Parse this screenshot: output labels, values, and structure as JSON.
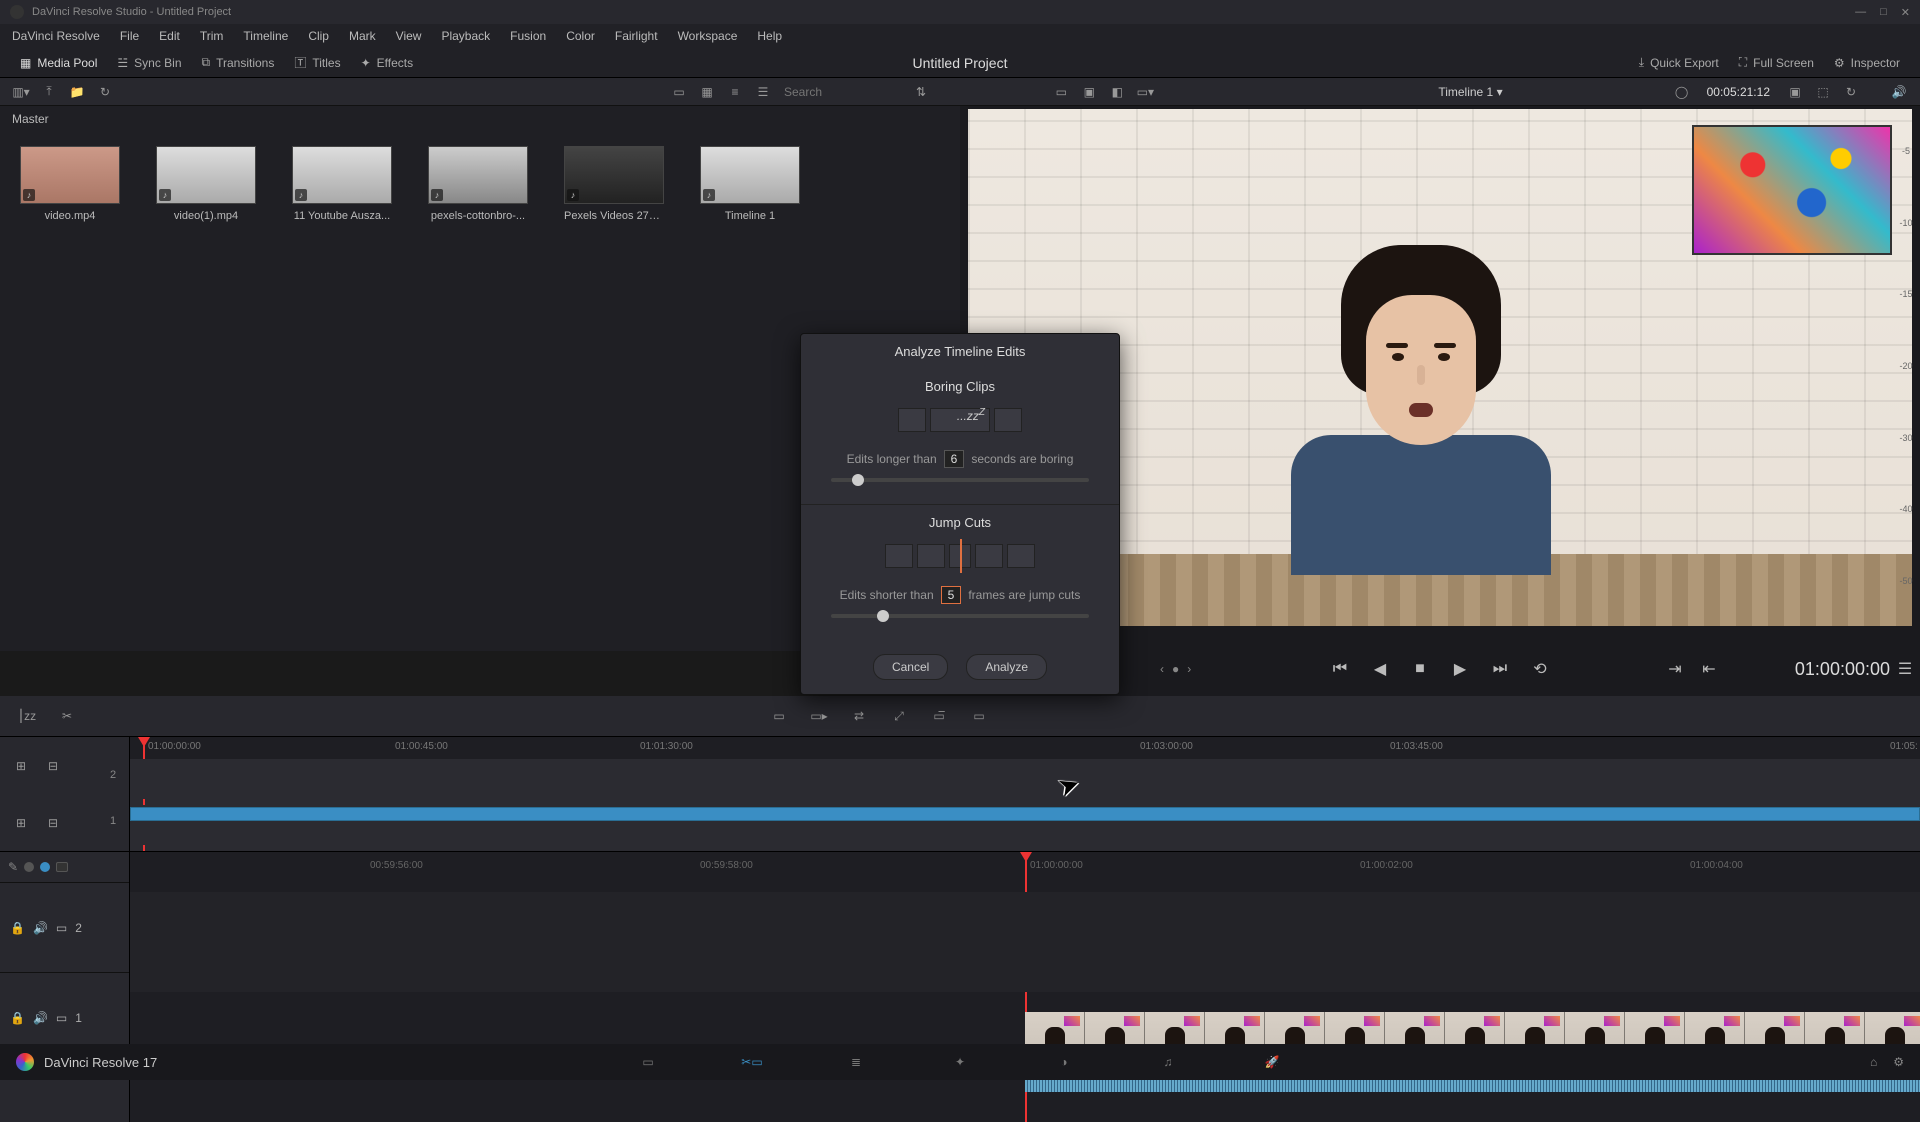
{
  "titlebar": {
    "text": "DaVinci Resolve Studio - Untitled Project"
  },
  "menu": [
    "DaVinci Resolve",
    "File",
    "Edit",
    "Trim",
    "Timeline",
    "Clip",
    "Mark",
    "View",
    "Playback",
    "Fusion",
    "Color",
    "Fairlight",
    "Workspace",
    "Help"
  ],
  "toolbar": {
    "media_pool": "Media Pool",
    "sync_bin": "Sync Bin",
    "transitions": "Transitions",
    "titles": "Titles",
    "effects": "Effects",
    "project_title": "Untitled Project",
    "quick_export": "Quick Export",
    "full_screen": "Full Screen",
    "inspector": "Inspector"
  },
  "secbar": {
    "search_placeholder": "Search",
    "timeline_name": "Timeline 1",
    "timecode": "00:05:21:12"
  },
  "media": {
    "master": "Master",
    "clips": [
      {
        "name": "video.mp4",
        "cls": "beach"
      },
      {
        "name": "video(1).mp4",
        "cls": "face"
      },
      {
        "name": "11 Youtube Ausza...",
        "cls": "face"
      },
      {
        "name": "pexels-cottonbro-...",
        "cls": "skate"
      },
      {
        "name": "Pexels Videos 279...",
        "cls": "dark"
      },
      {
        "name": "Timeline 1",
        "cls": "face"
      }
    ]
  },
  "meter_marks": [
    "-5",
    "-10",
    "-15",
    "-20",
    "-30",
    "-40",
    "-50"
  ],
  "transport": {
    "tc": "01:00:00:00"
  },
  "ruler": [
    "01:00:00:00",
    "01:00:45:00",
    "01:01:30:00",
    "01:03:00:00",
    "01:03:45:00",
    "01:05:"
  ],
  "ruler2": [
    "00:59:56:00",
    "00:59:58:00",
    "01:00:00:00",
    "01:00:02:00",
    "01:00:04:00"
  ],
  "tracks": {
    "v2": "2",
    "v1": "1"
  },
  "dialog": {
    "title": "Analyze Timeline Edits",
    "boring_title": "Boring Clips",
    "boring_pre": "Edits longer than",
    "boring_val": "6",
    "boring_post": "seconds are boring",
    "jump_title": "Jump Cuts",
    "jump_pre": "Edits shorter than",
    "jump_val": "5",
    "jump_post": "frames are jump cuts",
    "cancel": "Cancel",
    "analyze": "Analyze"
  },
  "pagebar": {
    "app": "DaVinci Resolve 17"
  }
}
